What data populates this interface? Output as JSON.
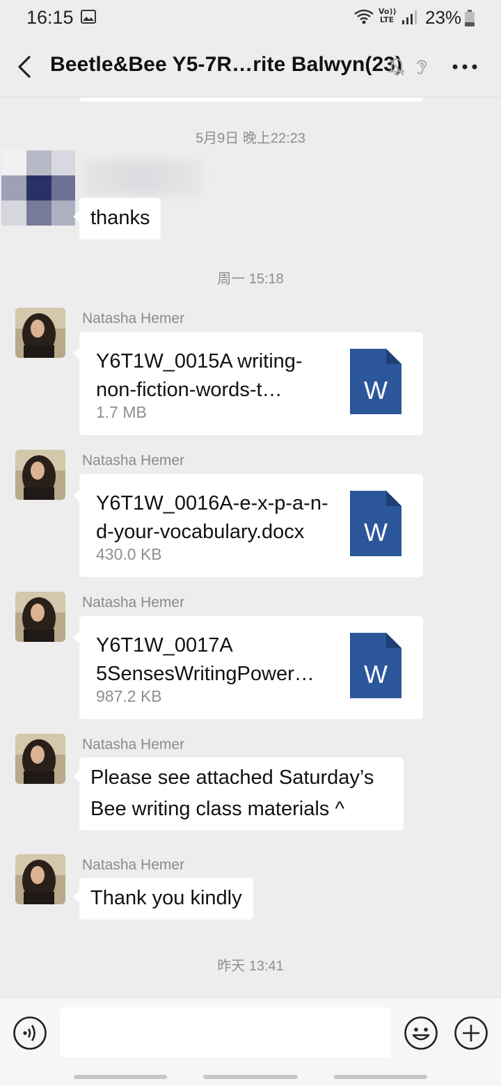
{
  "status_bar": {
    "time": "16:15",
    "lte_label": "Vo)) LTE",
    "battery": "23%"
  },
  "header": {
    "title": "Beetle&Bee Y5-7R…rite Balwyn(23)",
    "icons": [
      "back-icon",
      "mute-icon",
      "ear-icon",
      "more-icon"
    ]
  },
  "chat": {
    "timestamps": {
      "t1": "5月9日 晚上22:23",
      "t2": "周一 15:18",
      "t3": "昨天 13:41"
    },
    "messages": [
      {
        "type": "text",
        "sender": "",
        "text": "thanks"
      },
      {
        "type": "file",
        "sender": "Natasha Hemer",
        "file_name_line1": "Y6T1W_0015A writing-",
        "file_name_line2": "non-fiction-words-t…",
        "size": "1.7 MB",
        "file_icon_label": "W"
      },
      {
        "type": "file",
        "sender": "Natasha Hemer",
        "file_name_line1": "Y6T1W_0016A-e-x-p-a-n-",
        "file_name_line2": "d-your-vocabulary.docx",
        "size": "430.0 KB",
        "file_icon_label": "W"
      },
      {
        "type": "file",
        "sender": "Natasha Hemer",
        "file_name_line1": "Y6T1W_0017A",
        "file_name_line2": "5SensesWritingPower…",
        "size": "987.2 KB",
        "file_icon_label": "W"
      },
      {
        "type": "text",
        "sender": "Natasha Hemer",
        "text_line1": "Please see attached Saturday’s",
        "text_line2": "Bee writing class materials ^"
      },
      {
        "type": "text",
        "sender": "Natasha Hemer",
        "text": "Thank you kindly"
      }
    ]
  },
  "input_bar": {
    "placeholder": "",
    "icons": [
      "voice-icon",
      "emoji-icon",
      "plus-icon"
    ]
  },
  "colors": {
    "background": "#ededed",
    "bubble": "#ffffff",
    "word_blue": "#2b579a",
    "meta_gray": "#8e8e8e"
  }
}
